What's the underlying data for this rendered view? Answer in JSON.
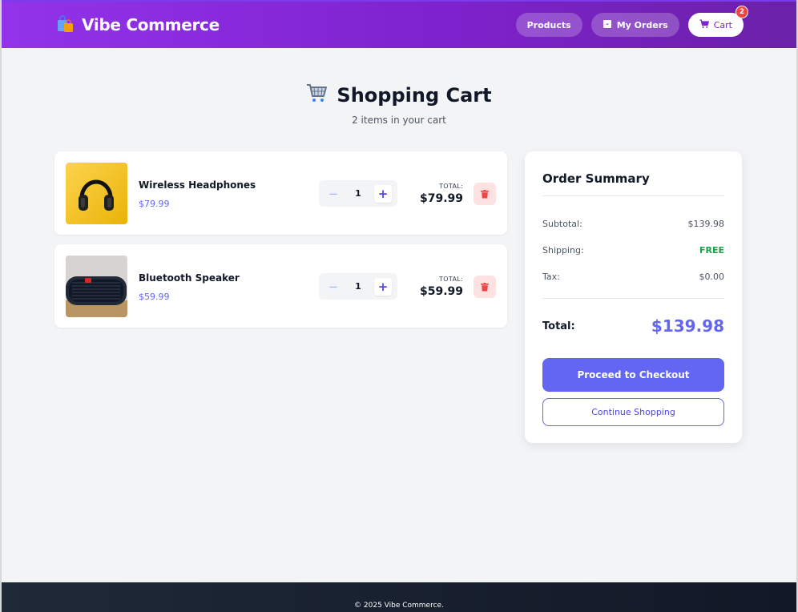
{
  "header": {
    "brand_name": "Vibe Commerce",
    "nav": {
      "products_label": "Products",
      "orders_label": "My Orders",
      "cart_label": "Cart",
      "cart_count": "2"
    }
  },
  "page": {
    "title": "Shopping Cart",
    "subtitle": "2 items in your cart"
  },
  "cart": {
    "items": [
      {
        "name": "Wireless Headphones",
        "price": "$79.99",
        "quantity": "1",
        "total_label": "TOTAL:",
        "total": "$79.99"
      },
      {
        "name": "Bluetooth Speaker",
        "price": "$59.99",
        "quantity": "1",
        "total_label": "TOTAL:",
        "total": "$59.99"
      }
    ]
  },
  "summary": {
    "title": "Order Summary",
    "subtotal_label": "Subtotal:",
    "subtotal": "$139.98",
    "shipping_label": "Shipping:",
    "shipping": "FREE",
    "tax_label": "Tax:",
    "tax": "$0.00",
    "total_label": "Total:",
    "total": "$139.98",
    "checkout_label": "Proceed to Checkout",
    "continue_label": "Continue Shopping"
  },
  "footer": {
    "copyright": "© 2025 Vibe Commerce."
  },
  "colors": {
    "brand_gradient_start": "#9333ea",
    "brand_gradient_end": "#6b21a8",
    "accent": "#6366f1",
    "free_shipping": "#16a34a",
    "delete": "#ef4444"
  },
  "icons": {
    "brand": "shopping-bags-icon",
    "orders": "package-icon",
    "cart": "cart-icon",
    "title": "shopping-cart-icon",
    "delete": "trash-icon"
  }
}
